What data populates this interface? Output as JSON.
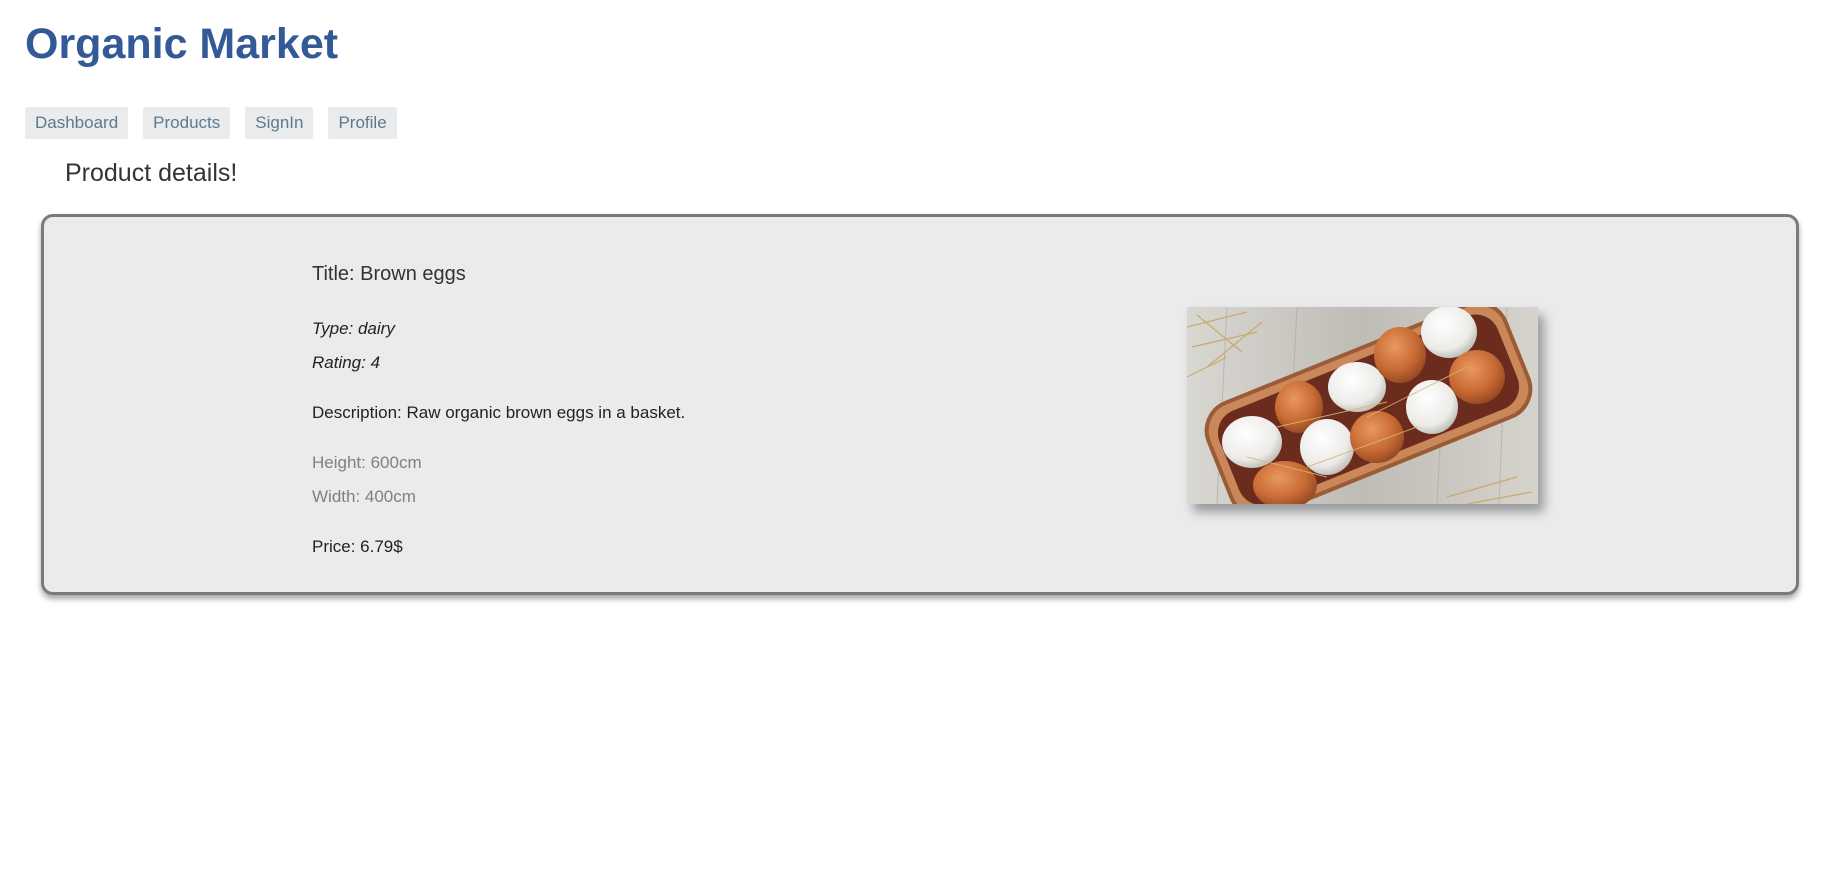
{
  "app": {
    "title": "Organic Market"
  },
  "nav": {
    "items": [
      {
        "label": "Dashboard"
      },
      {
        "label": "Products"
      },
      {
        "label": "SignIn"
      },
      {
        "label": "Profile"
      }
    ]
  },
  "page": {
    "heading": "Product details!"
  },
  "product": {
    "title": "Title: Brown eggs",
    "type": "Type: dairy",
    "rating": "Rating: 4",
    "description": "Description: Raw organic brown eggs in a basket.",
    "height": "Height: 600cm",
    "width": "Width: 400cm",
    "price": "Price: 6.79$"
  },
  "image": {
    "subject": "brown and white eggs in a woven wooden basket with straw"
  },
  "colors": {
    "brand": "#335a97",
    "nav_bg": "#eaebec",
    "nav_text": "#5d7a8c",
    "card_bg": "#eaebec",
    "card_border": "#7a7a7a",
    "muted_text": "#808080"
  }
}
